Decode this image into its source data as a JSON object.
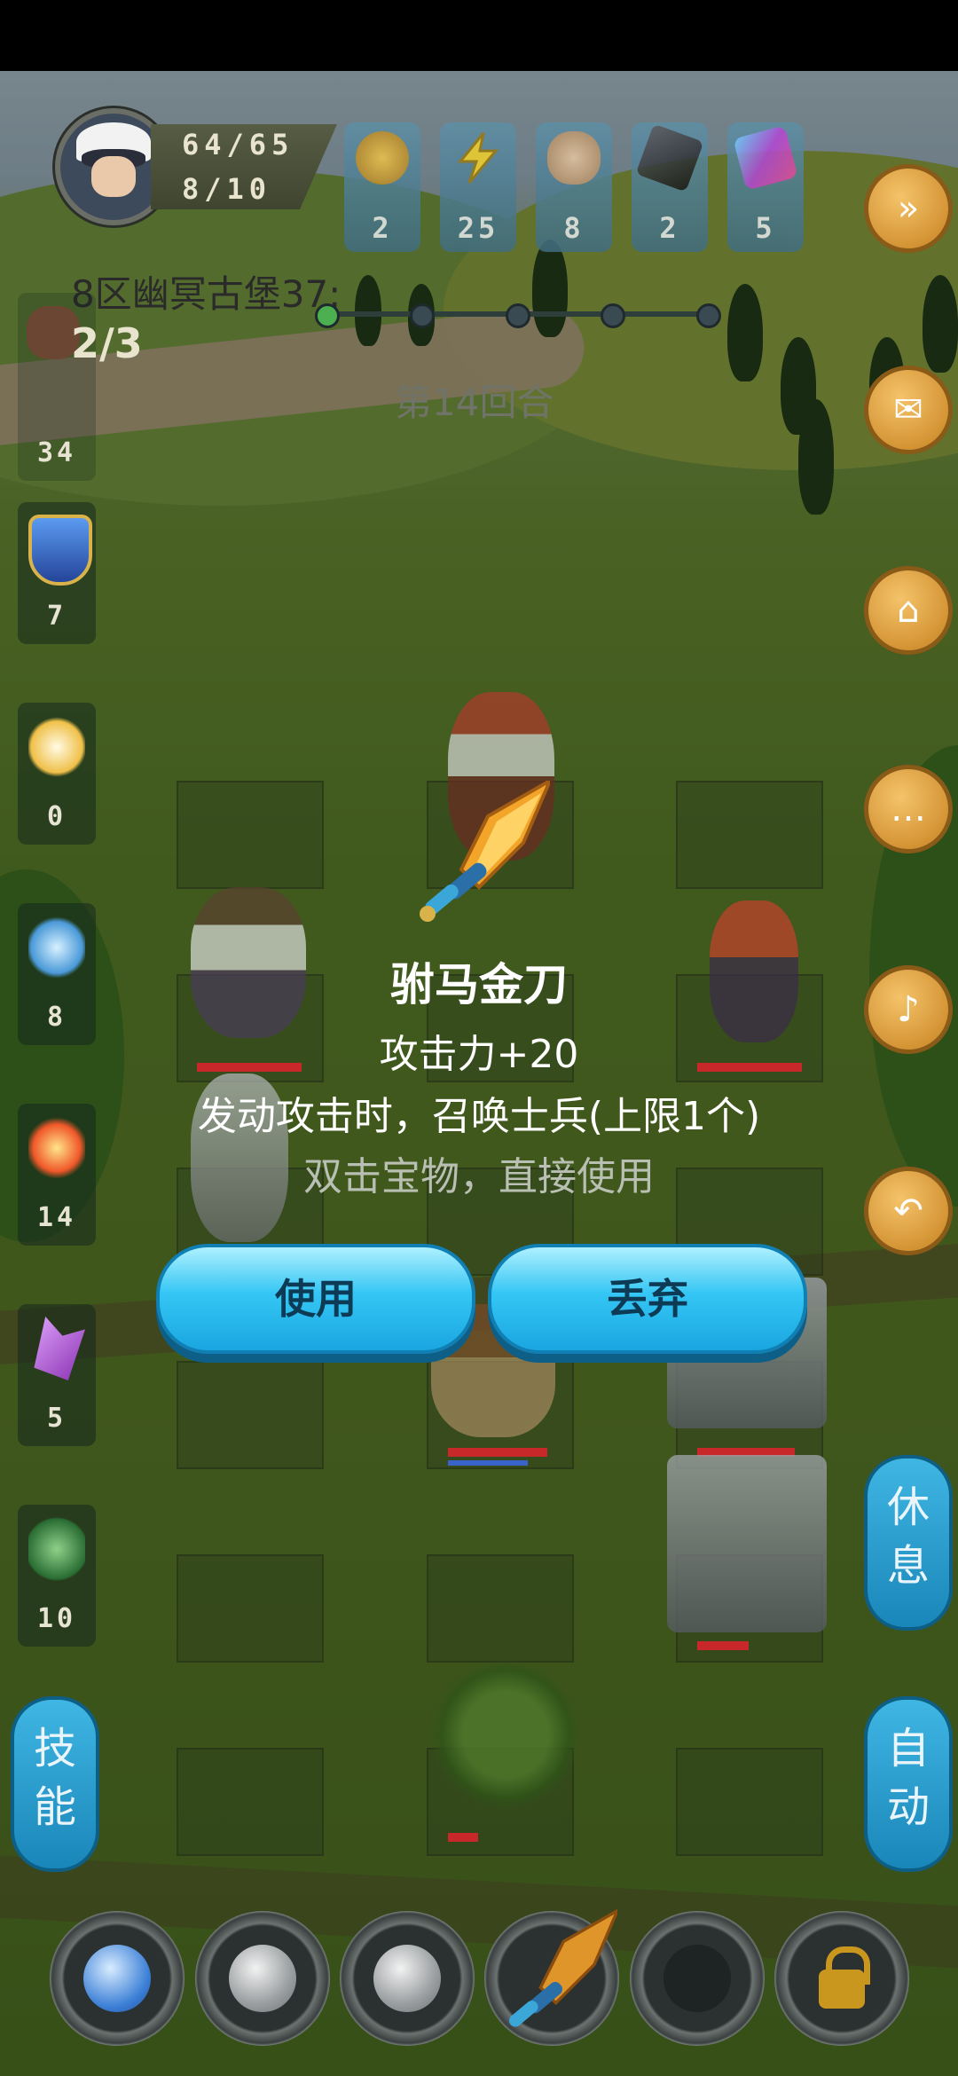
{
  "player": {
    "hp": "64/65",
    "energy": "8/10"
  },
  "resources": [
    {
      "icon": "gold-coin-icon",
      "count": "2",
      "color": "#d9a72b"
    },
    {
      "icon": "lightning-icon",
      "count": "25",
      "color": "#f2d12a"
    },
    {
      "icon": "bread-icon",
      "count": "8",
      "color": "#d8b48a"
    },
    {
      "icon": "black-stone-icon",
      "count": "2",
      "color": "#2a2d33"
    },
    {
      "icon": "purple-gem-icon",
      "count": "5",
      "color": "#b347d6"
    }
  ],
  "stage": {
    "name": "8区幽冥古堡37:",
    "attempts": "2/3",
    "power": "34",
    "round": "第14回合"
  },
  "left_slots": [
    {
      "icon": "shield-icon",
      "count": "7",
      "color": "#3f7ac9"
    },
    {
      "icon": "light-pillar-icon",
      "count": "0",
      "color": "#f1e7b8"
    },
    {
      "icon": "water-swirl-icon",
      "count": "8",
      "color": "#6bb9e8"
    },
    {
      "icon": "fire-burst-icon",
      "count": "14",
      "color": "#f0582a"
    },
    {
      "icon": "purple-crystal-icon",
      "count": "5",
      "color": "#b14fd6"
    },
    {
      "icon": "green-slime-icon",
      "count": "10",
      "color": "#3f9a4a"
    }
  ],
  "side_buttons": {
    "rest": "休息",
    "skill": "技能",
    "auto": "自动"
  },
  "item": {
    "name": "驸马金刀",
    "attack": "攻击力+20",
    "effect": "发动攻击时，召唤士兵(上限1个)",
    "hint": "双击宝物，直接使用",
    "use_label": "使用",
    "discard_label": "丢弃"
  },
  "colors": {
    "button_blue": "#34c6f4",
    "hp_red": "#c9282b",
    "orange_button": "#e6a33a"
  }
}
